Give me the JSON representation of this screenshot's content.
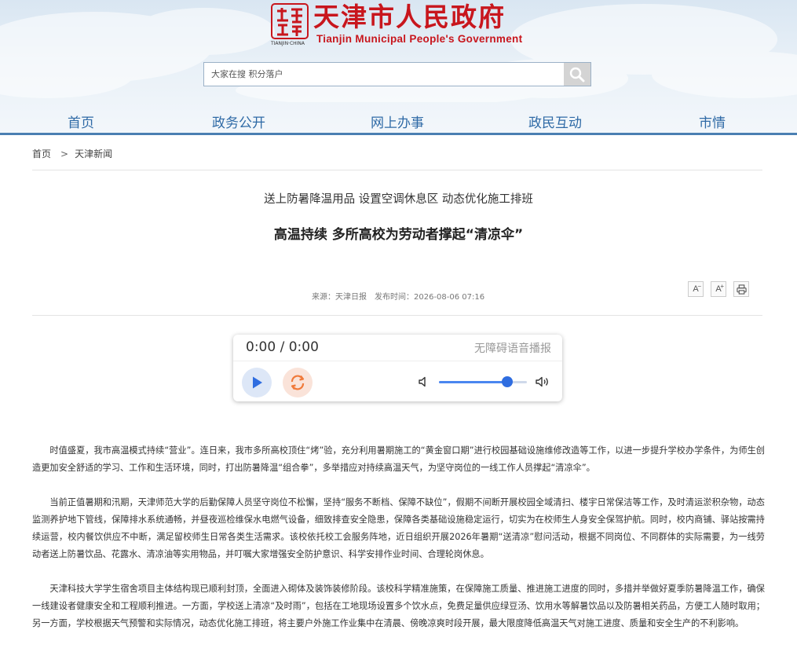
{
  "header": {
    "seal_text": "TIANJIN·CHINA",
    "logo_cn": "天津市人民政府",
    "logo_en": "Tianjin Municipal People's Government",
    "search_placeholder": "大家在搜 积分落户",
    "nav": [
      "首页",
      "政务公开",
      "网上办事",
      "政民互动",
      "市情"
    ]
  },
  "breadcrumb": {
    "home": "首页",
    "sep": ">",
    "current": "天津新闻"
  },
  "article": {
    "subtitle": "送上防暑降温用品 设置空调休息区 动态优化施工排班",
    "title": "高温持续 多所高校为劳动者撑起“清凉伞”",
    "source": "来源：天津日报",
    "published": "发布时间：2026-08-06 07:16",
    "tools": {
      "shrink": "A",
      "enlarge": "A",
      "print_icon": "printer-icon"
    },
    "paragraphs": [
      "时值盛夏，我市高温模式持续“营业”。连日来，我市多所高校顶住“烤”验，充分利用暑期施工的“黄金窗口期”进行校园基础设施维修改造等工作，以进一步提升学校办学条件，为师生创造更加安全舒适的学习、工作和生活环境，同时，打出防暑降温“组合拳”，多举措应对持续高温天气，为坚守岗位的一线工作人员撑起“清凉伞”。",
      "当前正值暑期和汛期，天津师范大学的后勤保障人员坚守岗位不松懈，坚持“服务不断档、保障不缺位”，假期不间断开展校园全域清扫、楼宇日常保洁等工作，及时清运淤积杂物，动态监测养护地下管线，保障排水系统通畅，并昼夜巡检维保水电燃气设备，细致排查安全隐患，保障各类基础设施稳定运行，切实为在校师生人身安全保驾护航。同时，校内商铺、驿站按需持续运营，校内餐饮供应不中断，满足留校师生日常各类生活需求。该校依托校工会服务阵地，近日组织开展2026年暑期“送清凉”慰问活动，根据不同岗位、不同群体的实际需要，为一线劳动者送上防暑饮品、花露水、清凉油等实用物品，并叮嘱大家增强安全防护意识、科学安排作业时间、合理轮岗休息。",
      "天津科技大学学生宿舍项目主体结构现已顺利封顶，全面进入砌体及装饰装修阶段。该校科学精准施策，在保障施工质量、推进施工进度的同时，多措并举做好夏季防暑降温工作，确保一线建设者健康安全和工程顺利推进。一方面，学校送上清凉“及时雨”，包括在工地现场设置多个饮水点，免费足量供应绿豆汤、饮用水等解暑饮品以及防暑相关药品，方便工人随时取用；另一方面，学校根据天气预警和实际情况，动态优化施工排班，将主要户外施工作业集中在清晨、傍晚凉爽时段开展，最大限度降低高温天气对施工进度、质量和安全生产的不利影响。"
    ]
  },
  "player": {
    "time": "0:00 / 0:00",
    "label": "无障碍语音播报",
    "volume_level": 0.78,
    "colors": {
      "accent": "#2f6de0",
      "play_bg": "#dde7f7",
      "replay_bg": "#fae3d9",
      "replay": "#f07a3a"
    }
  },
  "colors": {
    "brand_red": "#c8161d",
    "nav_blue": "#2f6aa6"
  }
}
